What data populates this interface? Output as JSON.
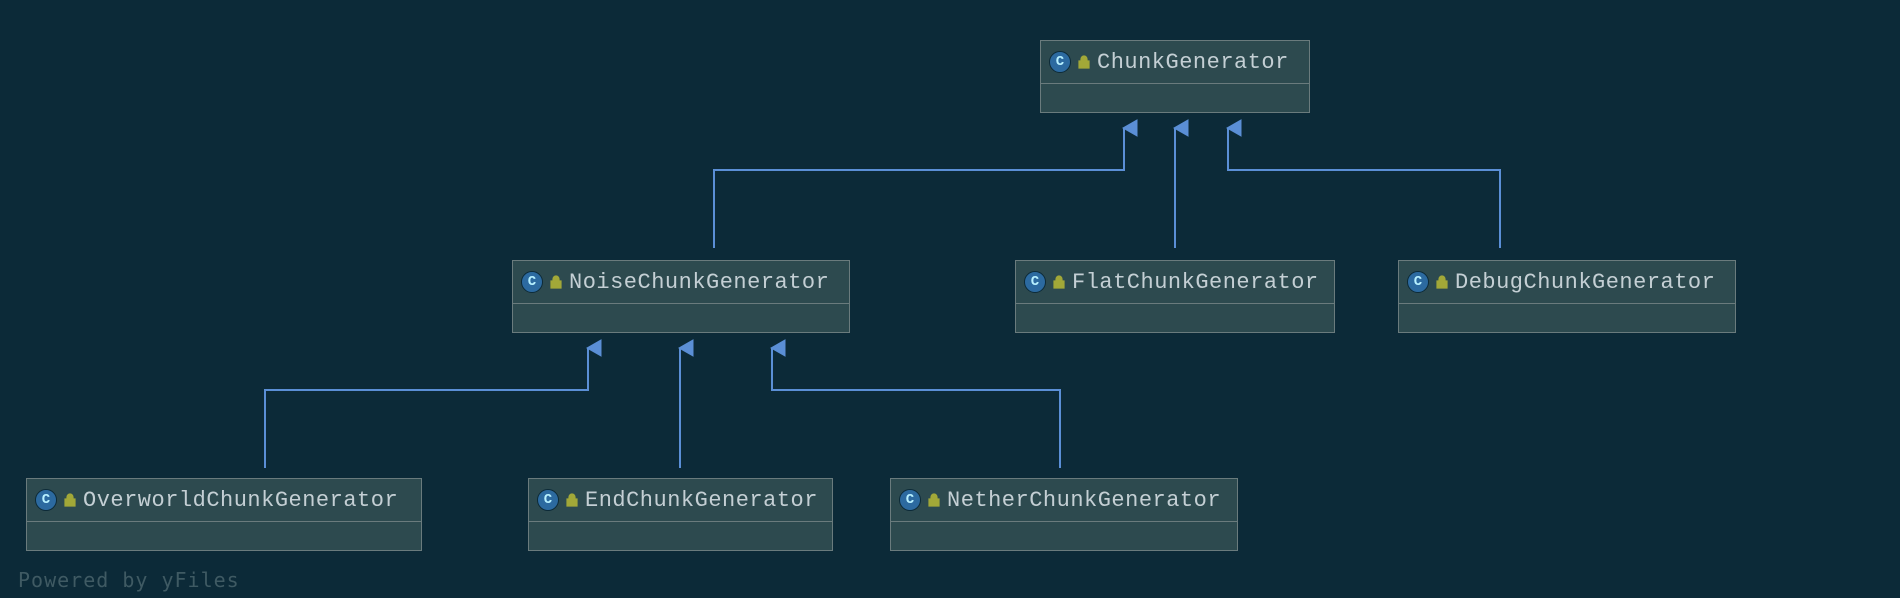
{
  "watermark": "Powered by yFiles",
  "nodes": {
    "chunkGenerator": {
      "label": "ChunkGenerator",
      "abstract": true
    },
    "noiseChunkGenerator": {
      "label": "NoiseChunkGenerator",
      "abstract": true
    },
    "flatChunkGenerator": {
      "label": "FlatChunkGenerator",
      "abstract": false
    },
    "debugChunkGenerator": {
      "label": "DebugChunkGenerator",
      "abstract": false
    },
    "overworldChunkGenerator": {
      "label": "OverworldChunkGenerator",
      "abstract": false
    },
    "endChunkGenerator": {
      "label": "EndChunkGenerator",
      "abstract": false
    },
    "netherChunkGenerator": {
      "label": "NetherChunkGenerator",
      "abstract": false
    }
  },
  "edges": [
    {
      "from": "noiseChunkGenerator",
      "to": "chunkGenerator"
    },
    {
      "from": "flatChunkGenerator",
      "to": "chunkGenerator"
    },
    {
      "from": "debugChunkGenerator",
      "to": "chunkGenerator"
    },
    {
      "from": "overworldChunkGenerator",
      "to": "noiseChunkGenerator"
    },
    {
      "from": "endChunkGenerator",
      "to": "noiseChunkGenerator"
    },
    {
      "from": "netherChunkGenerator",
      "to": "noiseChunkGenerator"
    }
  ],
  "chart_data": {
    "type": "tree",
    "title": "",
    "root": "ChunkGenerator",
    "nodes": [
      "ChunkGenerator",
      "NoiseChunkGenerator",
      "FlatChunkGenerator",
      "DebugChunkGenerator",
      "OverworldChunkGenerator",
      "EndChunkGenerator",
      "NetherChunkGenerator"
    ],
    "edges_child_to_parent": [
      [
        "NoiseChunkGenerator",
        "ChunkGenerator"
      ],
      [
        "FlatChunkGenerator",
        "ChunkGenerator"
      ],
      [
        "DebugChunkGenerator",
        "ChunkGenerator"
      ],
      [
        "OverworldChunkGenerator",
        "NoiseChunkGenerator"
      ],
      [
        "EndChunkGenerator",
        "NoiseChunkGenerator"
      ],
      [
        "NetherChunkGenerator",
        "NoiseChunkGenerator"
      ]
    ]
  }
}
